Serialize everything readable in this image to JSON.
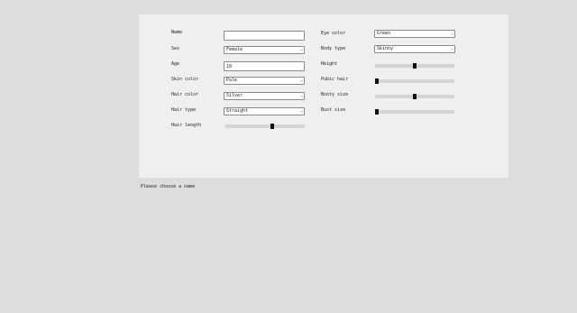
{
  "form": {
    "left": [
      {
        "label": "Name",
        "type": "text",
        "value": ""
      },
      {
        "label": "Sex",
        "type": "select",
        "value": "Female"
      },
      {
        "label": "Age",
        "type": "text",
        "value": "18"
      },
      {
        "label": "Skin color",
        "type": "select",
        "value": "Pale"
      },
      {
        "label": "Hair color",
        "type": "select",
        "value": "Silver"
      },
      {
        "label": "Hair type",
        "type": "select",
        "value": "Straight"
      },
      {
        "label": "Hair length",
        "type": "slider",
        "value": 0.6
      }
    ],
    "right": [
      {
        "label": "Eye color",
        "type": "select",
        "value": "Green"
      },
      {
        "label": "Body type",
        "type": "select",
        "value": "Skinny"
      },
      {
        "label": "Height",
        "type": "slider",
        "value": 0.5
      },
      {
        "label": "Pubic hair",
        "type": "slider",
        "value": 0.0
      },
      {
        "label": "Booty size",
        "type": "slider",
        "value": 0.5
      },
      {
        "label": "Bust size",
        "type": "slider",
        "value": 0.0
      }
    ]
  },
  "icons": {
    "dropdown": "chevron-down-icon",
    "dropdown_glyph": "⌄"
  },
  "status_text": "Please choose a name"
}
